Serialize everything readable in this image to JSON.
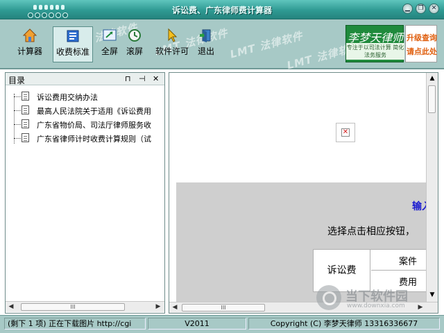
{
  "window": {
    "title": "诉讼费、广东律师费计算器",
    "min_glyph": "▁",
    "restore_glyph": "❐",
    "close_glyph": "✕"
  },
  "toolbar": {
    "items": [
      {
        "label": "计算器",
        "icon": "house-icon"
      },
      {
        "label": "收费标准",
        "icon": "book-icon"
      },
      {
        "label": "全屏",
        "icon": "fullscreen-icon"
      },
      {
        "label": "滚屏",
        "icon": "scroll-icon"
      },
      {
        "label": "软件许可",
        "icon": "cursor-icon"
      },
      {
        "label": "退出",
        "icon": "exit-door-icon"
      }
    ],
    "watermarks": [
      "LMT 法律软件",
      "LMT 法律软件",
      "LMT 法律软件",
      "LMT 法律软件"
    ],
    "ad_lawyer_name": "李梦天律师",
    "ad_lawyer_slogan": "专注于以司法计算 简化法务服务",
    "ad_upgrade_line1": "升级查询",
    "ad_upgrade_line2": "请点此处"
  },
  "left_pane": {
    "title": "目录",
    "pin_glyph": "⊓",
    "dock_glyph": "⊣",
    "close_glyph": "✕",
    "tree_items": [
      "诉讼费用交纳办法",
      "最高人民法院关于适用《诉讼费用",
      "广东省物价局、司法厅律师服务收",
      "广东省律师计时收费计算规则（试"
    ],
    "hscroll_grip": "III",
    "arrow_left": "◀",
    "arrow_right": "▶"
  },
  "right_pane": {
    "blue_heading": "输入",
    "instruction": "选择点击相应按钮，",
    "fee_table": {
      "row_label": "诉讼费",
      "cell_top": "案件",
      "cell_bottom": "费用"
    },
    "hscroll_grip": "III",
    "arrow_up": "▲",
    "arrow_down": "▼",
    "arrow_left": "◀",
    "arrow_right": "▶",
    "site_watermark_name": "当下软件园",
    "site_watermark_url": "www.downxia.com"
  },
  "status_bar": {
    "download": "(剩下 1 项) 正在下载图片 http://cgi",
    "version": "V2011",
    "copyright": "Copyright (C) 李梦天律师 13316336677"
  },
  "colors": {
    "titlebar": "#2f9a93",
    "toolbar": "#a7c9c6",
    "status_bar": "#a7c9c6",
    "link_blue": "#1b1bd0",
    "broken_image_red": "#d21c1c"
  }
}
